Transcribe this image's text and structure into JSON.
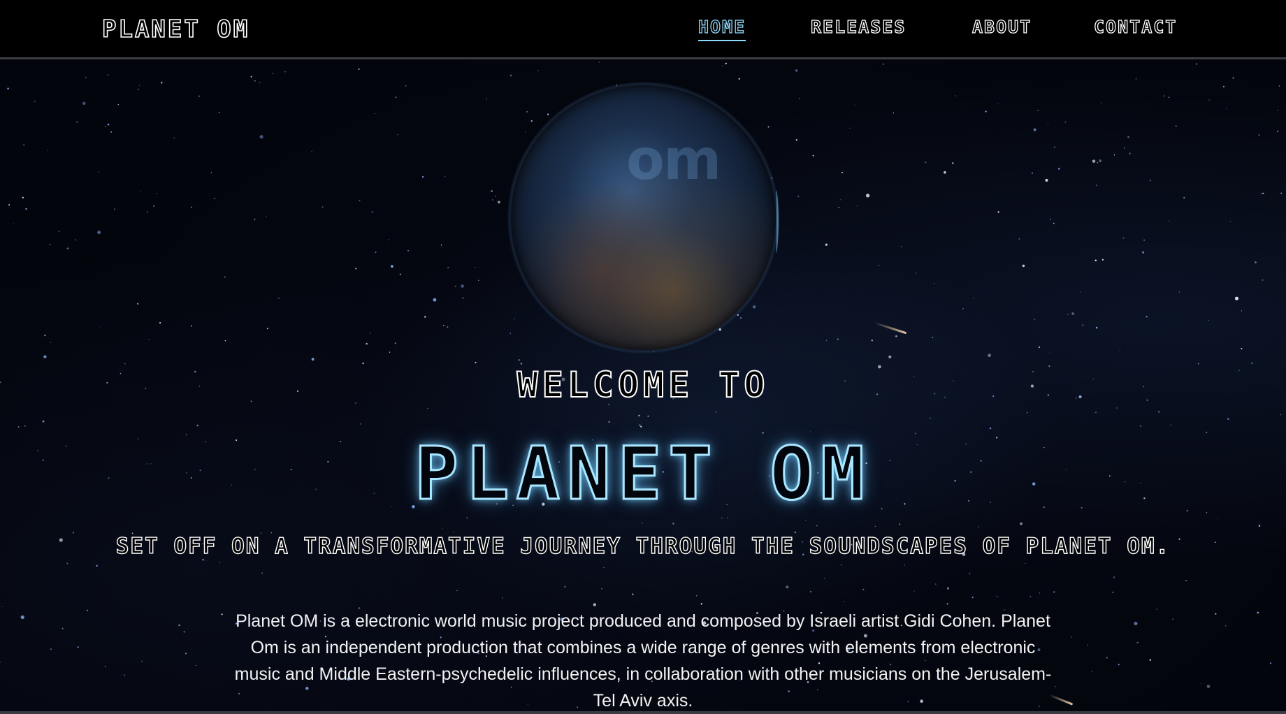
{
  "header": {
    "logo": "PLANET OM",
    "nav": [
      {
        "label": "HOME",
        "active": true
      },
      {
        "label": "RELEASES",
        "active": false
      },
      {
        "label": "ABOUT",
        "active": false
      },
      {
        "label": "CONTACT",
        "active": false
      }
    ]
  },
  "hero": {
    "planet_label": "om",
    "welcome": "WELCOME TO",
    "title": "PLANET OM",
    "tagline": "SET OFF ON A TRANSFORMATIVE JOURNEY THROUGH THE SOUNDSCAPES OF PLANET OM.",
    "description": "Planet OM is a electronic world music project produced and composed by Israeli artist Gidi Cohen. Planet Om is an independent production that combines a wide range of genres with elements from electronic music and Middle Eastern-psychedelic influences, in collaboration with other musicians on the Jerusalem-Tel Aviv axis."
  },
  "colors": {
    "accent": "#8fdcff",
    "title_glow": "#a9e6ff",
    "background": "#03050c",
    "header_bg": "#000000"
  }
}
